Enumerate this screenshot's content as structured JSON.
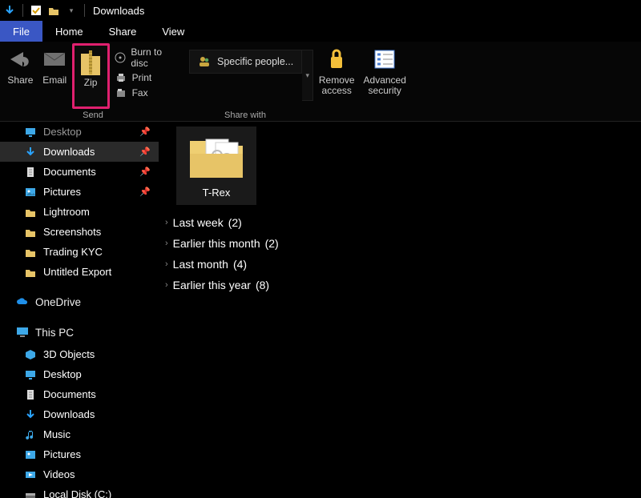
{
  "window": {
    "title": "Downloads"
  },
  "tabs": {
    "file": "File",
    "home": "Home",
    "share": "Share",
    "view": "View"
  },
  "ribbon": {
    "share": {
      "label": "Share"
    },
    "email": {
      "label": "Email"
    },
    "zip": {
      "label": "Zip"
    },
    "burn": {
      "label": "Burn to disc"
    },
    "print": {
      "label": "Print"
    },
    "fax": {
      "label": "Fax"
    },
    "send_group": "Send",
    "specific": {
      "label": "Specific people..."
    },
    "removeaccess": {
      "label1": "Remove",
      "label2": "access"
    },
    "advsec": {
      "label1": "Advanced",
      "label2": "security"
    },
    "sharewith_group": "Share with"
  },
  "sidebar": {
    "desktop_qa": "Desktop",
    "quick": [
      {
        "label": "Downloads",
        "pinned": true,
        "selected": true
      },
      {
        "label": "Documents",
        "pinned": true
      },
      {
        "label": "Pictures",
        "pinned": true
      },
      {
        "label": "Lightroom"
      },
      {
        "label": "Screenshots"
      },
      {
        "label": "Trading KYC"
      },
      {
        "label": "Untitled Export"
      }
    ],
    "onedrive": "OneDrive",
    "thispc": "This PC",
    "pc": [
      {
        "label": "3D Objects"
      },
      {
        "label": "Desktop"
      },
      {
        "label": "Documents"
      },
      {
        "label": "Downloads"
      },
      {
        "label": "Music"
      },
      {
        "label": "Pictures"
      },
      {
        "label": "Videos"
      },
      {
        "label": "Local Disk (C:)"
      }
    ]
  },
  "content": {
    "folder": {
      "name": "T-Rex"
    },
    "groups": [
      {
        "label": "Last week",
        "count": "(2)"
      },
      {
        "label": "Earlier this month",
        "count": "(2)"
      },
      {
        "label": "Last month",
        "count": "(4)"
      },
      {
        "label": "Earlier this year",
        "count": "(8)"
      }
    ]
  }
}
